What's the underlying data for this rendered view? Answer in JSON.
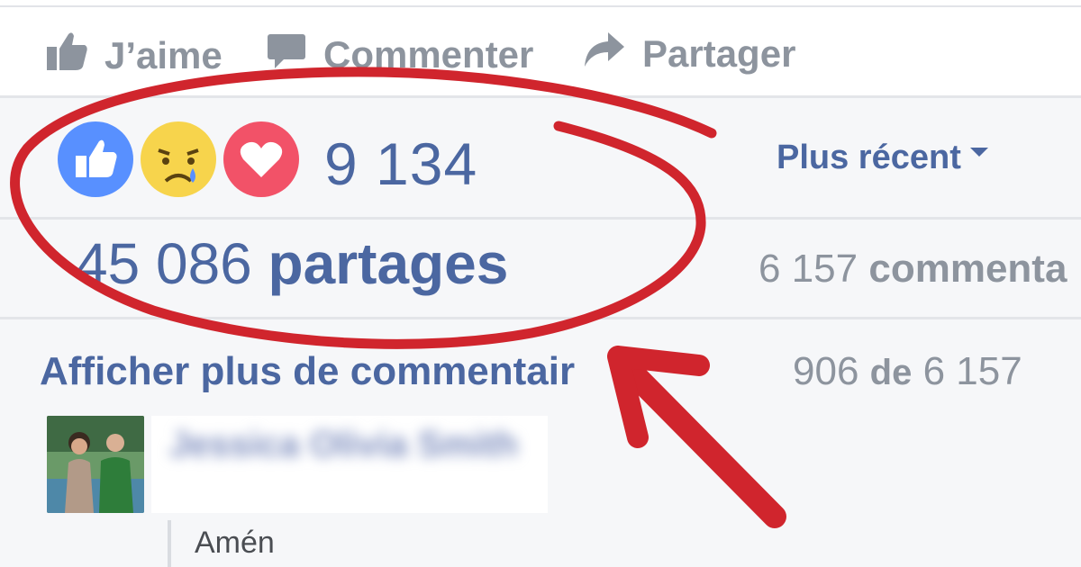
{
  "actions": {
    "like_label": "J’aime",
    "comment_label": "Commenter",
    "share_label": "Partager"
  },
  "reactions": {
    "icons": [
      "like-icon",
      "sad-icon",
      "love-icon"
    ],
    "count": "9 134"
  },
  "sort": {
    "label": "Plus récent"
  },
  "shares": {
    "number": "45 086",
    "word": "partages"
  },
  "comments": {
    "number": "6 157",
    "word": "commenta"
  },
  "more_comments": {
    "label": "Afficher plus de commentair",
    "shown": "906",
    "of_word": "de",
    "total": "6 157"
  },
  "comment": {
    "author": "Jessica Olivia Smith",
    "reply_text": "Amén"
  },
  "colors": {
    "fb_blue": "#4b67a1",
    "grey_text": "#8d949e",
    "annotation_red": "#d0252d",
    "like_blue": "#5890ff",
    "love_red": "#f25268",
    "sad_yellow": "#f7d44c"
  }
}
